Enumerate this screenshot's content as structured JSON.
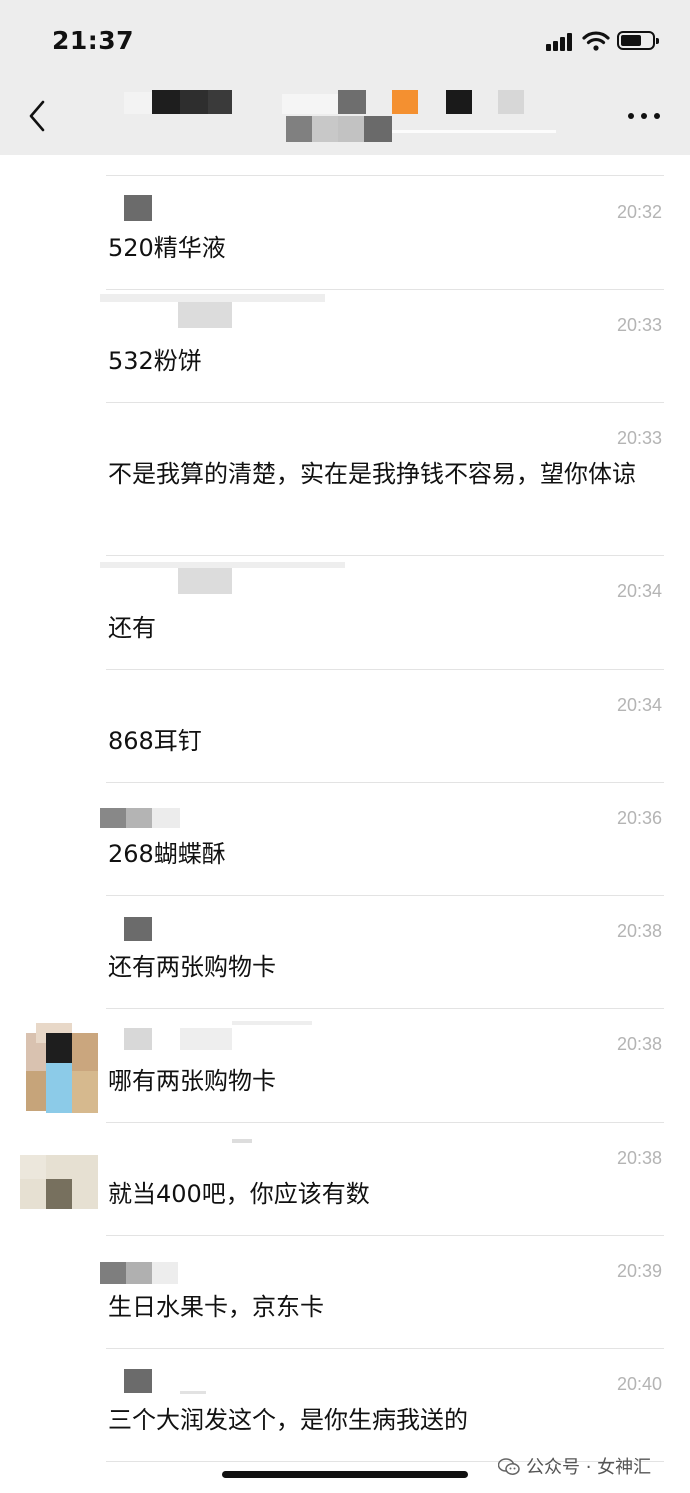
{
  "status_bar": {
    "time": "21:37"
  },
  "header": {
    "title": ""
  },
  "messages": [
    {
      "time": "20:32",
      "text": "520精华液"
    },
    {
      "time": "20:33",
      "text": "532粉饼"
    },
    {
      "time": "20:33",
      "text": "不是我算的清楚，实在是我挣钱不容易，望你体谅"
    },
    {
      "time": "20:34",
      "text": "还有"
    },
    {
      "time": "20:34",
      "text": "868耳钉"
    },
    {
      "time": "20:36",
      "text": "268蝴蝶酥"
    },
    {
      "time": "20:38",
      "text": "还有两张购物卡"
    },
    {
      "time": "20:38",
      "text": "哪有两张购物卡"
    },
    {
      "time": "20:38",
      "text": "就当400吧，你应该有数"
    },
    {
      "time": "20:39",
      "text": "生日水果卡，京东卡"
    },
    {
      "time": "20:40",
      "text": "三个大润发这个，是你生病我送的"
    }
  ],
  "watermark": {
    "text": "公众号 · 女神汇"
  },
  "icons": [
    "back-icon",
    "more-icon",
    "signal-icon",
    "wifi-icon",
    "battery-icon",
    "wechat-watermark-icon"
  ],
  "colors": {
    "header_bg": "#ededed",
    "timestamp": "#b4b4b4",
    "divider": "#e3e3e3"
  }
}
